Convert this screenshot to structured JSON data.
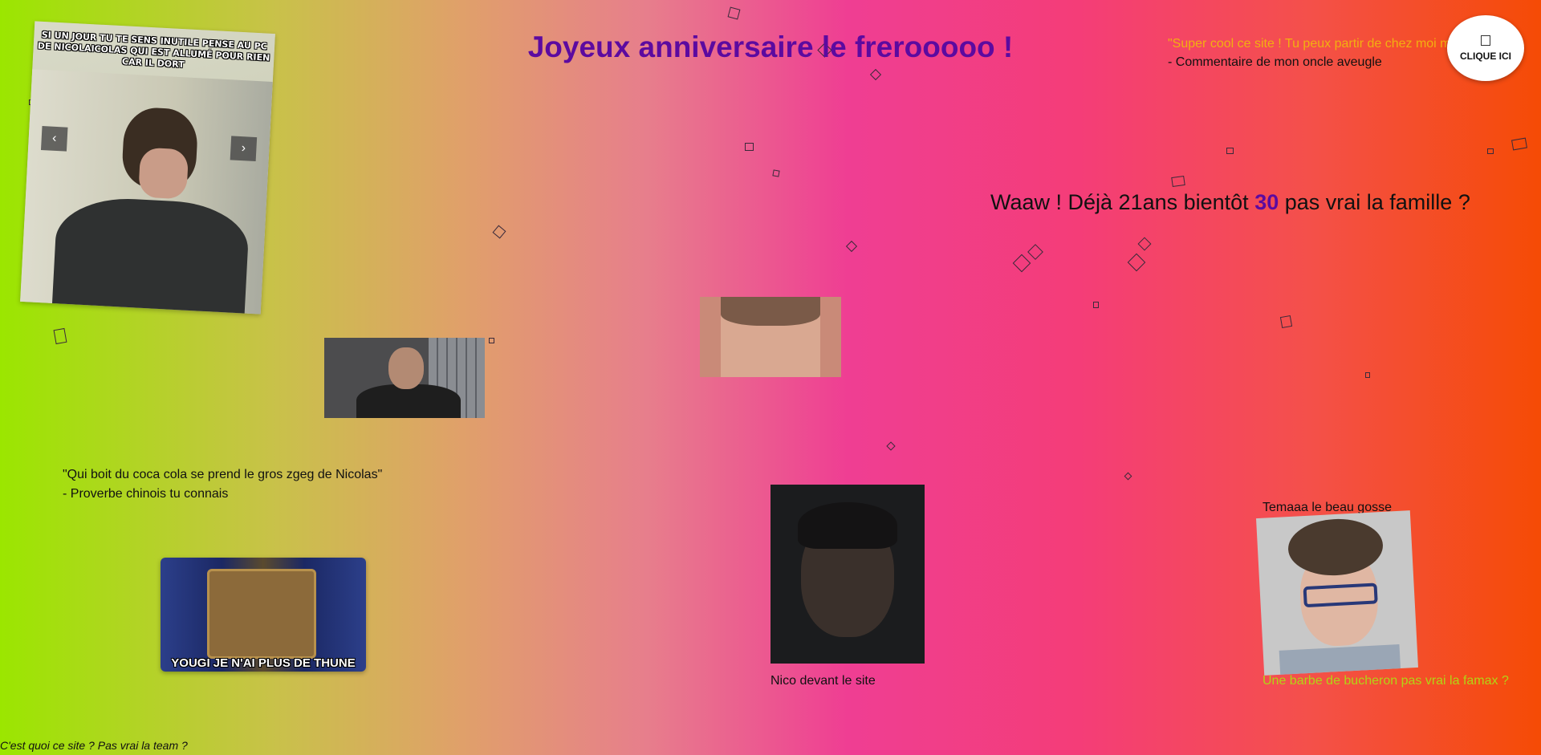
{
  "page": {
    "title": "Joyeux anniversaire le frerooooo !",
    "gradient_colors": [
      "#9be600",
      "#ef3e93",
      "#f54b05"
    ],
    "title_color": "#5c0aa0"
  },
  "carousel": {
    "meme_text": "SI UN JOUR TU TE SENS INUTILE PENSE AU PC DE NICOLAICOLAS QUI EST ALLUMÉ POUR RIEN CAR IL DORT",
    "prev_label": "‹",
    "next_label": "›"
  },
  "top_quote": {
    "quote": "\"Super cool ce site ! Tu peux partir de chez moi m",
    "author": "- Commentaire de mon oncle aveugle"
  },
  "click_button": {
    "label": "CLIQUE ICI",
    "icon": "gift-icon"
  },
  "age_message": {
    "prefix": "Waaw ! Déjà 21ans bientôt ",
    "number": "30",
    "suffix": " pas vrai la famille ?"
  },
  "proverb": {
    "quote": "\"Qui boit du coca cola se prend le gros zgeg de Nicolas\"",
    "author": "- Proverbe chinois tu connais"
  },
  "yougi_image": {
    "caption": "YOUGI JE N'AI PLUS DE THUNE"
  },
  "nico_image": {
    "caption": "Nico devant le site"
  },
  "temaaa_image": {
    "caption": "Temaaa le beau gosse",
    "subtitle": "Une barbe de bucheron pas vrai la famax ?",
    "subtitle_color": "#b2d415"
  },
  "footer": {
    "text": "C'est quoi ce site ? Pas vrai la team ?"
  }
}
